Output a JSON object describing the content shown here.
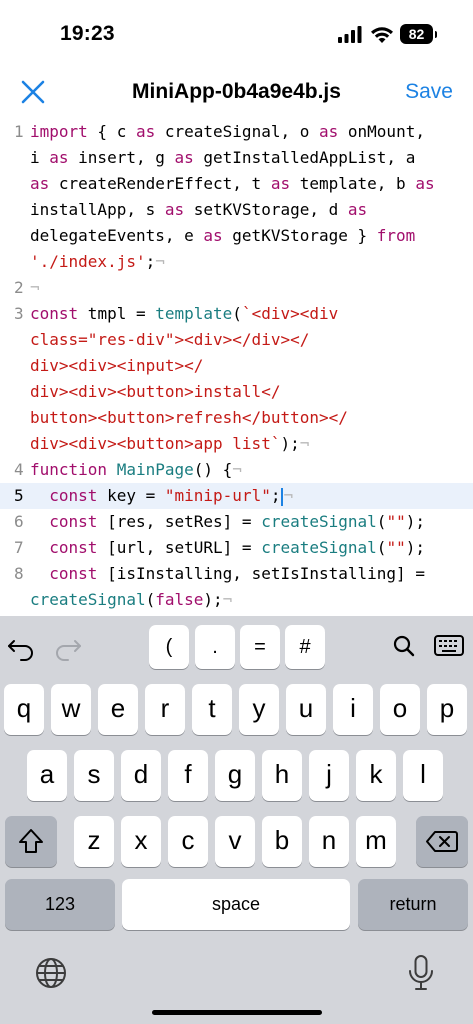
{
  "status": {
    "time": "19:23",
    "battery": "82"
  },
  "nav": {
    "title": "MiniApp-0b4a9e4b.js",
    "save_label": "Save"
  },
  "editor": {
    "line_numbers": [
      "1",
      "2",
      "3",
      "4",
      "5",
      "6",
      "7",
      "8"
    ],
    "rows": [
      {
        "num": "1",
        "parts": [
          [
            "kw",
            "import"
          ],
          [
            "p",
            " { c "
          ],
          [
            "kw",
            "as"
          ],
          [
            "p",
            " createSignal, o "
          ],
          [
            "kw",
            "as"
          ],
          [
            "p",
            " onMount,"
          ]
        ]
      },
      {
        "num": "",
        "parts": [
          [
            "p",
            "i "
          ],
          [
            "kw",
            "as"
          ],
          [
            "p",
            " insert, g "
          ],
          [
            "kw",
            "as"
          ],
          [
            "p",
            " getInstalledAppList, a"
          ]
        ]
      },
      {
        "num": "",
        "parts": [
          [
            "kw",
            "as"
          ],
          [
            "p",
            " createRenderEffect, t "
          ],
          [
            "kw",
            "as"
          ],
          [
            "p",
            " template, b "
          ],
          [
            "kw",
            "as"
          ]
        ]
      },
      {
        "num": "",
        "parts": [
          [
            "p",
            "installApp, s "
          ],
          [
            "kw",
            "as"
          ],
          [
            "p",
            " setKVStorage, d "
          ],
          [
            "kw",
            "as"
          ]
        ]
      },
      {
        "num": "",
        "parts": [
          [
            "p",
            "delegateEvents, e "
          ],
          [
            "kw",
            "as"
          ],
          [
            "p",
            " getKVStorage } "
          ],
          [
            "kw",
            "from"
          ]
        ]
      },
      {
        "num": "",
        "parts": [
          [
            "str",
            "'./index.js'"
          ],
          [
            "p",
            ";"
          ],
          [
            "ws",
            "¬"
          ]
        ]
      },
      {
        "num": "2",
        "parts": [
          [
            "ws",
            "¬"
          ]
        ]
      },
      {
        "num": "3",
        "parts": [
          [
            "kw",
            "const"
          ],
          [
            "p",
            " tmpl = "
          ],
          [
            "fn",
            "template"
          ],
          [
            "p",
            "("
          ],
          [
            "str",
            "`<div><div"
          ]
        ]
      },
      {
        "num": "",
        "parts": [
          [
            "str",
            "class=\"res-div\"><div></div></"
          ]
        ]
      },
      {
        "num": "",
        "parts": [
          [
            "str",
            "div><div><input></"
          ]
        ]
      },
      {
        "num": "",
        "parts": [
          [
            "str",
            "div><div><button>install</"
          ]
        ]
      },
      {
        "num": "",
        "parts": [
          [
            "str",
            "button><button>refresh</button></"
          ]
        ]
      },
      {
        "num": "",
        "parts": [
          [
            "str",
            "div><div><button>app list`"
          ]
        ],
        "tail": [
          [
            "p",
            ");"
          ],
          [
            "ws",
            "¬"
          ]
        ]
      },
      {
        "num": "4",
        "parts": [
          [
            "kw",
            "function"
          ],
          [
            "p",
            " "
          ],
          [
            "fn",
            "MainPage"
          ],
          [
            "p",
            "() {"
          ],
          [
            "ws",
            "¬"
          ]
        ]
      },
      {
        "num": "5",
        "active": true,
        "parts": [
          [
            "p",
            "  "
          ],
          [
            "kw",
            "const"
          ],
          [
            "p",
            " key = "
          ],
          [
            "str",
            "\"minip-url\""
          ],
          [
            "p",
            ";"
          ],
          [
            "ws",
            "¬"
          ]
        ]
      },
      {
        "num": "6",
        "parts": [
          [
            "p",
            "  "
          ],
          [
            "kw",
            "const"
          ],
          [
            "p",
            " [res, setRes] = "
          ],
          [
            "fn",
            "createSignal"
          ],
          [
            "p",
            "("
          ],
          [
            "str",
            "\"\""
          ],
          [
            "p",
            ");"
          ]
        ]
      },
      {
        "num": "7",
        "parts": [
          [
            "p",
            "  "
          ],
          [
            "kw",
            "const"
          ],
          [
            "p",
            " [url, setURL] = "
          ],
          [
            "fn",
            "createSignal"
          ],
          [
            "p",
            "("
          ],
          [
            "str",
            "\"\""
          ],
          [
            "p",
            ");"
          ]
        ]
      },
      {
        "num": "8",
        "parts": [
          [
            "p",
            "  "
          ],
          [
            "kw",
            "const"
          ],
          [
            "p",
            " [isInstalling, setIsInstalling] ="
          ]
        ]
      },
      {
        "num": "",
        "parts": [
          [
            "fn",
            "createSignal"
          ],
          [
            "p",
            "("
          ],
          [
            "kw",
            "false"
          ],
          [
            "p",
            ");"
          ],
          [
            "ws",
            "¬"
          ]
        ]
      }
    ]
  },
  "keyboard": {
    "accessory": [
      "(",
      ".",
      "=",
      "#"
    ],
    "row1": [
      "q",
      "w",
      "e",
      "r",
      "t",
      "y",
      "u",
      "i",
      "o",
      "p"
    ],
    "row2": [
      "a",
      "s",
      "d",
      "f",
      "g",
      "h",
      "j",
      "k",
      "l"
    ],
    "row3": [
      "z",
      "x",
      "c",
      "v",
      "b",
      "n",
      "m"
    ],
    "numbers_label": "123",
    "space_label": "space",
    "return_label": "return"
  }
}
